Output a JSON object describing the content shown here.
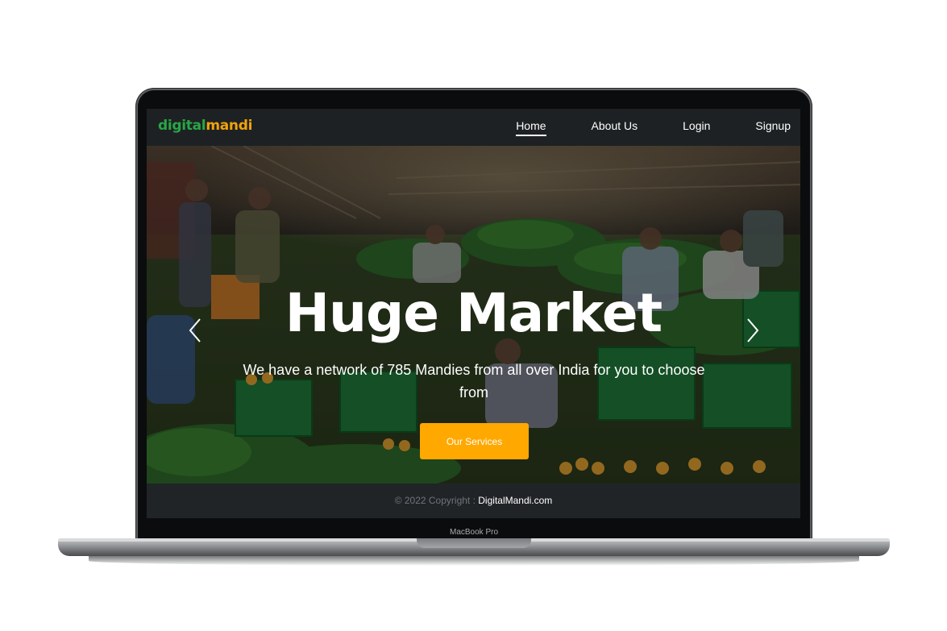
{
  "device": {
    "model_label": "MacBook Pro"
  },
  "navbar": {
    "logo": {
      "part1": "digital",
      "part2": "mandi"
    },
    "links": [
      {
        "label": "Home",
        "active": true
      },
      {
        "label": "About Us",
        "active": false
      },
      {
        "label": "Login",
        "active": false
      },
      {
        "label": "Signup",
        "active": false
      }
    ]
  },
  "hero": {
    "title": "Huge Market",
    "subtitle": "We have a network of 785 Mandies from all over India for you to choose from",
    "cta_label": "Our Services",
    "prev_icon": "chevron-left-icon",
    "next_icon": "chevron-right-icon"
  },
  "footer": {
    "copyright": "© 2022 Copyright : ",
    "site": "DigitalMandi.com"
  },
  "colors": {
    "brand_green": "#28a745",
    "brand_orange": "#f0a30a",
    "cta": "#ffa800",
    "nav_bg": "#1e2123",
    "footer_bg": "#212427"
  }
}
